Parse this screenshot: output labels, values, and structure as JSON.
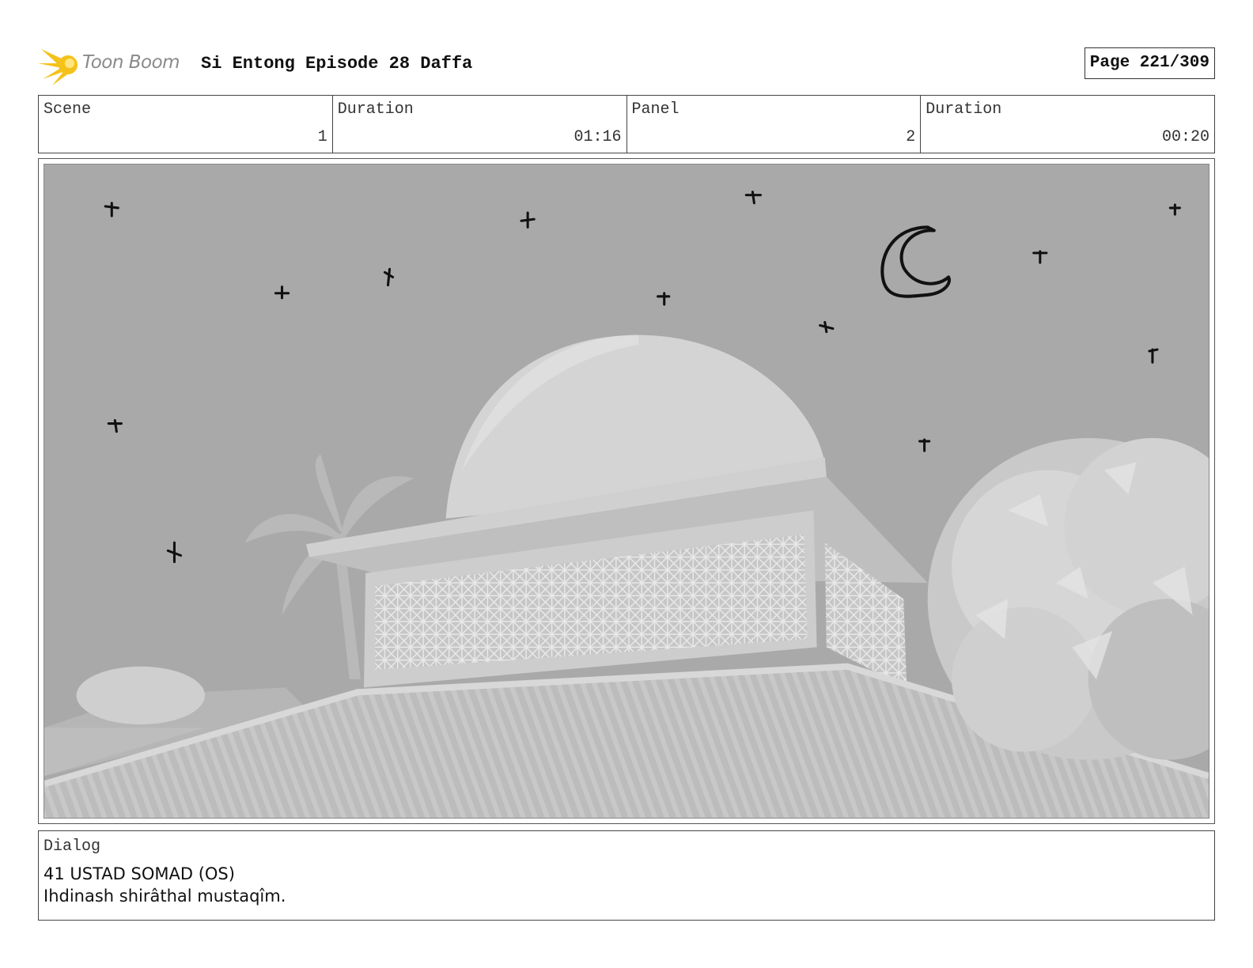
{
  "header": {
    "logo_text": "Toon Boom",
    "title": "Si Entong Episode 28 Daffa",
    "page": "Page 221/309"
  },
  "info": [
    {
      "label": "Scene",
      "value": "1"
    },
    {
      "label": "Duration",
      "value": "01:16"
    },
    {
      "label": "Panel",
      "value": "2"
    },
    {
      "label": "Duration",
      "value": "00:20"
    }
  ],
  "dialog": {
    "label": "Dialog",
    "line1": "41 USTAD SOMAD (OS)",
    "line2": "Ihdinash shirâthal mustaqîm."
  },
  "colors": {
    "logo_accent": "#f5c21b",
    "sky": "#a9a9a9"
  }
}
